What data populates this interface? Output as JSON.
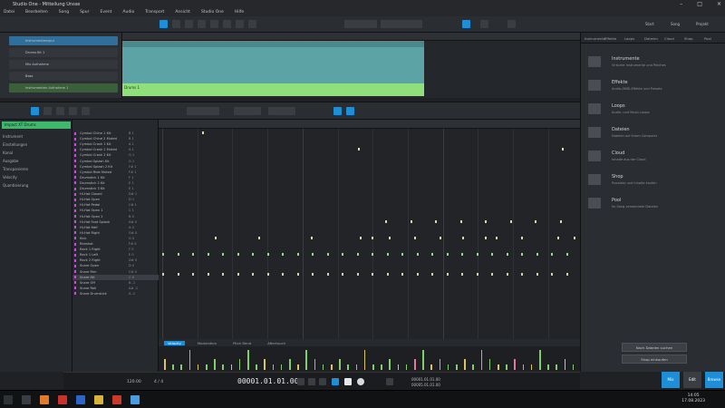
{
  "window": {
    "title": "Studio One - Mitteilung Unsse"
  },
  "menu": [
    "Datei",
    "Bearbeiten",
    "Song",
    "Spur",
    "Event",
    "Audio",
    "Transport",
    "Ansicht",
    "Studio One",
    "Hilfe"
  ],
  "toolbar": {
    "start_label": "Start",
    "song_label": "Song",
    "project_label": "Projekt"
  },
  "tracks": [
    "Instrumentenspur",
    "Drums Kit 1",
    "Mix Aufnahme",
    "Bass",
    "Instrumenten Aufnahme 1"
  ],
  "clip": {
    "label": "Drums 1"
  },
  "inspector": {
    "title": "Impact XT Drums",
    "rows": [
      "Instrument",
      "Einstellungen",
      "Kanal",
      "Ausgabe",
      "Transponieren",
      "Velocity",
      "Quantisierung"
    ]
  },
  "drums": [
    {
      "name": "Cymbal Chine 1 Kit",
      "val": "B 1"
    },
    {
      "name": "Cymbal Chine 2 Muted",
      "val": "B 1"
    },
    {
      "name": "Cymbal Crash 1 Kit",
      "val": "A 1"
    },
    {
      "name": "Cymbal Crash 2 Muted",
      "val": "A 1"
    },
    {
      "name": "Cymbal Crash 2 Kit",
      "val": "G 1"
    },
    {
      "name": "Cymbal Splash Kit",
      "val": "G 1"
    },
    {
      "name": "Cymbal Splash 2 Kit",
      "val": "F# 1"
    },
    {
      "name": "Cymbal Ride Muted",
      "val": "F# 1"
    },
    {
      "name": "Drumstick 1 Kit",
      "val": "F 1"
    },
    {
      "name": "Drumstick 2 Kit",
      "val": "E 1"
    },
    {
      "name": "Drumstick 3 Kit",
      "val": "E 1"
    },
    {
      "name": "Hi-Hat Closed",
      "val": "D# 1"
    },
    {
      "name": "Hi-Hat Open",
      "val": "D 1"
    },
    {
      "name": "Hi-Hat Pedal",
      "val": "C# 1"
    },
    {
      "name": "Hi-Hat Open 1",
      "val": "C 1"
    },
    {
      "name": "Hi-Hat Open 2",
      "val": "B 0"
    },
    {
      "name": "Hi-Hat Foot Splash",
      "val": "A# 0"
    },
    {
      "name": "Hi-Hat Half",
      "val": "A 0"
    },
    {
      "name": "Hi-Hat Right",
      "val": "G# 0"
    },
    {
      "name": "Kick",
      "val": "G 0"
    },
    {
      "name": "Rimshot",
      "val": "F# 0"
    },
    {
      "name": "Rack 1 Right",
      "val": "F 0"
    },
    {
      "name": "Rack 1 Left",
      "val": "E 0"
    },
    {
      "name": "Rack 2 Right",
      "val": "D# 0"
    },
    {
      "name": "Snare Open",
      "val": "D 0"
    },
    {
      "name": "Snare Rim",
      "val": "C# 0"
    },
    {
      "name": "Snare Hit",
      "val": "C 0"
    },
    {
      "name": "Snare Off",
      "val": "B -1"
    },
    {
      "name": "Snare Roll",
      "val": "A# -1"
    },
    {
      "name": "Snare Drumstick",
      "val": "A -1"
    }
  ],
  "editor_tabs": [
    "Velocity",
    "Modulation",
    "Pitch Bend",
    "Aftertouch"
  ],
  "browser": {
    "tabs": [
      "Instrumente",
      "Effekte",
      "Loops",
      "Dateien",
      "Cloud",
      "Shop",
      "Pool"
    ],
    "items": [
      {
        "name": "Instrumente",
        "desc": "Virtuelle Instrumente und Patches"
      },
      {
        "name": "Effekte",
        "desc": "Audio-/MIDI-Effekte und Presets"
      },
      {
        "name": "Loops",
        "desc": "Audio- und Music-Loops"
      },
      {
        "name": "Dateien",
        "desc": "Dateien auf Ihrem Computer"
      },
      {
        "name": "Cloud",
        "desc": "Inhalte aus der Cloud"
      },
      {
        "name": "Shop",
        "desc": "Produkte und Inhalte kaufen"
      },
      {
        "name": "Pool",
        "desc": "Im Song verwendete Dateien"
      }
    ],
    "btn1": "Nach Dateien suchen",
    "btn2": "Shop einkaufen"
  },
  "transport": {
    "time": "00001.01.01.00",
    "tempo": "120.00",
    "signature": "4 / 4",
    "left_pos": "00001.01.01.00",
    "right_pos": "00005.01.01.00"
  },
  "taskbar": {
    "time": "14:05",
    "date": "17.08.2023"
  },
  "bottom_right": {
    "mix": "Mix",
    "edit": "Edit",
    "browse": "Browse"
  }
}
